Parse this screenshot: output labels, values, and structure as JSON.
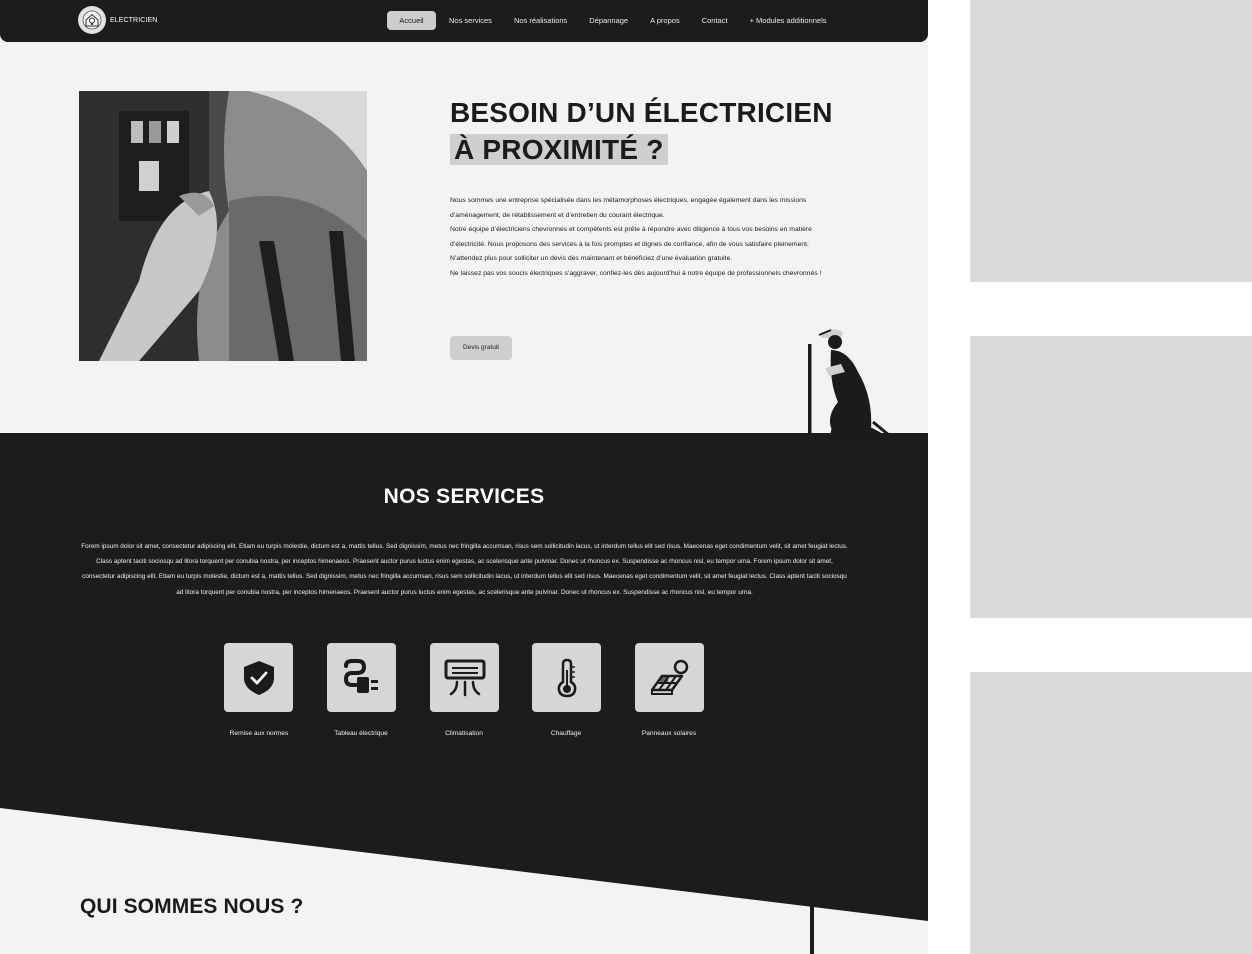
{
  "brand": {
    "name": "ELECTRICIEN"
  },
  "nav": {
    "items": [
      {
        "label": "Accueil",
        "active": true
      },
      {
        "label": "Nos services"
      },
      {
        "label": "Nos réalisations"
      },
      {
        "label": "Dépannage"
      },
      {
        "label": "A propos"
      },
      {
        "label": "Contact"
      },
      {
        "label": "+ Modules additionnels"
      }
    ]
  },
  "hero": {
    "title_line1": "BESOIN D’UN ÉLECTRICIEN",
    "title_line2": "À PROXIMITÉ ?",
    "paragraphs": [
      "Nous sommes une entreprise spécialisée dans les métamorphoses électriques, engagée également dans les missions d’aménagement, de rétablissement et d’entretien du courant électrique.",
      "Notre équipe d’électriciens chevronnés et compétents est prête à répondre avec diligence à tous vos besoins en matière d’électricité. Nous proposons des services à la fois promptes et dignes de confiance, afin de vous satisfaire pleinement. N’attendez plus pour solliciter un devis dès maintenant et bénéficiez d’une évaluation gratuite.",
      "Ne laissez pas vos soucis électriques s’aggraver, confiez-les dès aujourd’hui à notre équipe de professionnels chevronnés !"
    ],
    "cta_label": "Devis gratuit"
  },
  "services": {
    "title": "NOS SERVICES",
    "description": "Forem ipsum dolor sit amet, consectetur adipiscing elit. Etiam eu turpis molestie, dictum est a, mattis tellus. Sed dignissim, metus nec fringilla accumsan, risus sem sollicitudin lacus, ut interdum tellus elit sed risus. Maecenas eget condimentum velit, sit amet feugiat lectus. Class aptent taciti sociosqu ad litora torquent per conubia nostra, per inceptos himenaeos. Praesent auctor purus luctus enim egestas, ac scelerisque ante pulvinar. Donec ut rhoncus ex. Suspendisse ac rhoncus nisl, eu tempor urna. Forem ipsum dolor sit amet, consectetur adipiscing elit. Etiam eu turpis molestie, dictum est a, mattis tellus. Sed dignissim, metus nec fringilla accumsan, risus sem sollicitudin lacus, ut interdum tellus elit sed risus. Maecenas eget condimentum velit, sit amet feugiat lectus. Class aptent taciti sociosqu ad litora torquent per conubia nostra, per inceptos himenaeos. Praesent auctor purus luctus enim egestas, ac scelerisque ante pulvinar. Donec ut rhoncus ex. Suspendisse ac rhoncus nisl, eu tempor urna.",
    "items": [
      {
        "label": "Remise aux normes",
        "icon": "shield-check-icon"
      },
      {
        "label": "Tableau électrique",
        "icon": "plug-icon"
      },
      {
        "label": "Climatisation",
        "icon": "air-conditioner-icon"
      },
      {
        "label": "Chauffage",
        "icon": "thermometer-icon"
      },
      {
        "label": "Panneaux solaires",
        "icon": "solar-panel-icon"
      }
    ]
  },
  "about": {
    "title": "QUI SOMMES NOUS ?"
  },
  "colors": {
    "dark": "#1c1c1c",
    "light_bg": "#f3f3f3",
    "accent_gray": "#cfcfcf",
    "placeholder": "#d9d9d9"
  }
}
